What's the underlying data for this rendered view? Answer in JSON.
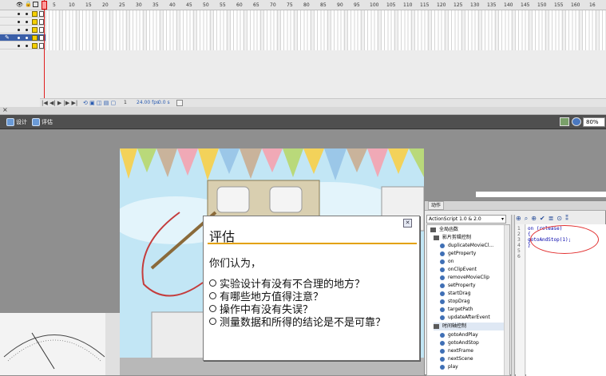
{
  "timeline": {
    "ruler_ticks": [
      "1",
      "5",
      "10",
      "15",
      "20",
      "25",
      "30",
      "35",
      "40",
      "45",
      "50",
      "55",
      "60",
      "65",
      "70",
      "75",
      "80",
      "85",
      "90",
      "95",
      "100",
      "105",
      "110",
      "115",
      "120",
      "125",
      "130",
      "135",
      "140",
      "145",
      "150",
      "155",
      "160",
      "16"
    ],
    "layer_count": 5,
    "status": {
      "frame": "1",
      "fps": "24.00 fps",
      "time": "0.0 s"
    }
  },
  "edit_bar": {
    "scenes": [
      "设计",
      "评估"
    ],
    "zoom": "80%"
  },
  "eval_panel": {
    "title": "评估",
    "close_label": "✕",
    "intro": "你们认为，",
    "questions": [
      "实验设计有没有不合理的地方？",
      "有哪些地方值得注意？",
      "操作中有没有失误？",
      "测量数据和所得的结论是不是可靠？"
    ]
  },
  "actions_panel": {
    "tab": "动作",
    "script_version": "ActionScript 1.0 & 2.0",
    "toolbar_icons": [
      "add-icon",
      "find-icon",
      "target-icon",
      "check-syntax-icon",
      "format-icon",
      "code-hint-icon",
      "debug-icon"
    ],
    "tree": [
      {
        "label": "全局函数",
        "kind": "book"
      },
      {
        "label": "影片剪辑控制",
        "kind": "book"
      },
      {
        "label": "duplicateMovieCl...",
        "kind": "item"
      },
      {
        "label": "getProperty",
        "kind": "item"
      },
      {
        "label": "on",
        "kind": "item"
      },
      {
        "label": "onClipEvent",
        "kind": "item"
      },
      {
        "label": "removeMovieClip",
        "kind": "item"
      },
      {
        "label": "setProperty",
        "kind": "item"
      },
      {
        "label": "startDrag",
        "kind": "item"
      },
      {
        "label": "stopDrag",
        "kind": "item"
      },
      {
        "label": "targetPath",
        "kind": "item"
      },
      {
        "label": "updateAfterEvent",
        "kind": "item"
      },
      {
        "label": "时间轴控制",
        "kind": "book"
      },
      {
        "label": "gotoAndPlay",
        "kind": "item"
      },
      {
        "label": "gotoAndStop",
        "kind": "item"
      },
      {
        "label": "nextFrame",
        "kind": "item"
      },
      {
        "label": "nextScene",
        "kind": "item"
      },
      {
        "label": "play",
        "kind": "item"
      }
    ],
    "line_numbers": [
      "1",
      "2",
      "3",
      "4",
      "5",
      "6"
    ],
    "code_lines": [
      "on (release)",
      "{",
      "    gotoAndStop(1);",
      "}",
      "",
      ""
    ]
  },
  "colors": {
    "accent": "#e3a100",
    "annotation": "#e23030",
    "playhead": "#e02020"
  }
}
